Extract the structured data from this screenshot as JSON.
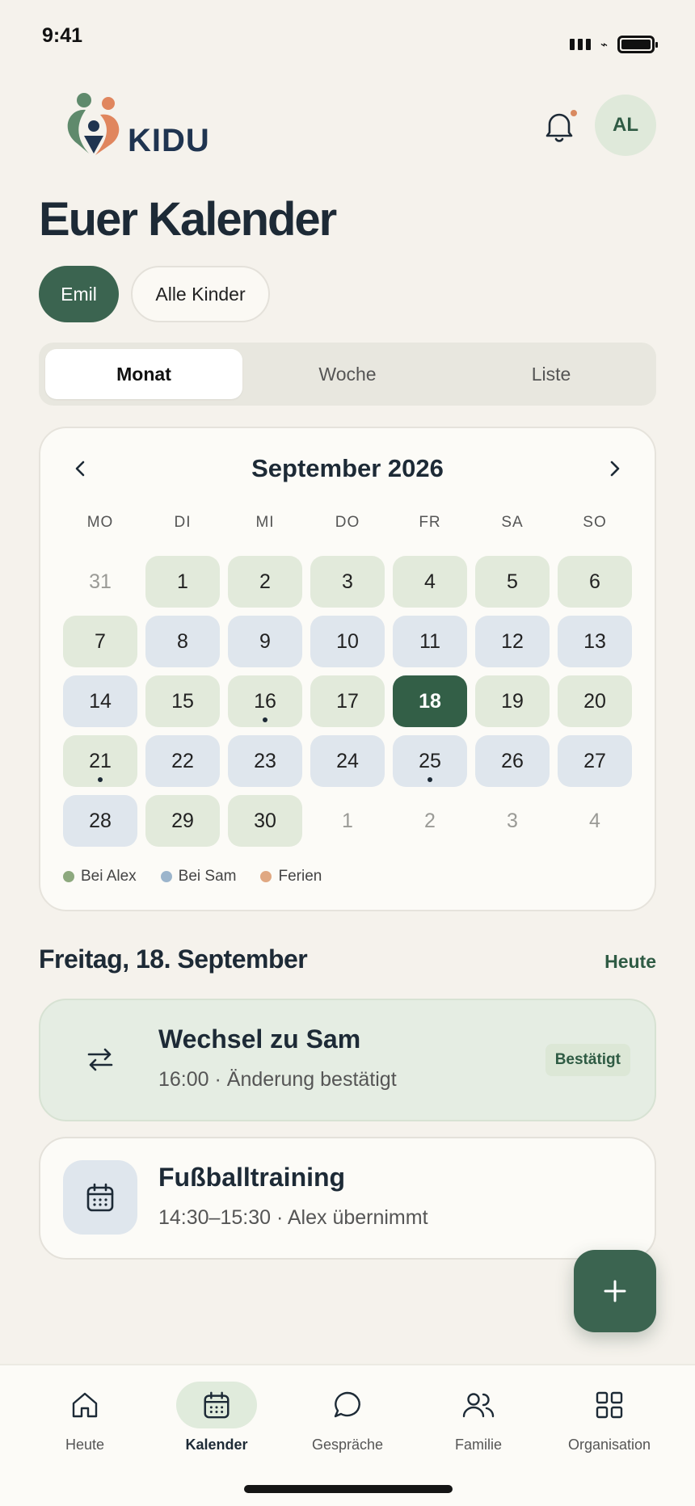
{
  "status": {
    "time": "9:41"
  },
  "app": {
    "brand": "KIDU",
    "avatar_initials": "AL",
    "title": "Euer Kalender"
  },
  "colors": {
    "accent": "#3b6450",
    "alex": "#8da97e",
    "sam": "#9cb5cc",
    "holiday": "#e0a882"
  },
  "chips": {
    "emil": "Emil",
    "all": "Alle Kinder"
  },
  "segments": {
    "month": "Monat",
    "week": "Woche",
    "list": "Liste"
  },
  "calendar": {
    "month_title": "September 2026",
    "weekdays": [
      "MO",
      "DI",
      "MI",
      "DO",
      "FR",
      "SA",
      "SO"
    ],
    "days": [
      {
        "d": "31",
        "t": "out"
      },
      {
        "d": "1",
        "t": "alex"
      },
      {
        "d": "2",
        "t": "alex"
      },
      {
        "d": "3",
        "t": "alex"
      },
      {
        "d": "4",
        "t": "alex"
      },
      {
        "d": "5",
        "t": "alex"
      },
      {
        "d": "6",
        "t": "alex"
      },
      {
        "d": "7",
        "t": "alex"
      },
      {
        "d": "8",
        "t": "sam"
      },
      {
        "d": "9",
        "t": "sam"
      },
      {
        "d": "10",
        "t": "sam"
      },
      {
        "d": "11",
        "t": "sam"
      },
      {
        "d": "12",
        "t": "sam"
      },
      {
        "d": "13",
        "t": "sam"
      },
      {
        "d": "14",
        "t": "sam"
      },
      {
        "d": "15",
        "t": "alex"
      },
      {
        "d": "16",
        "t": "alex",
        "dot": true
      },
      {
        "d": "17",
        "t": "alex"
      },
      {
        "d": "18",
        "t": "today"
      },
      {
        "d": "19",
        "t": "alex"
      },
      {
        "d": "20",
        "t": "alex"
      },
      {
        "d": "21",
        "t": "alex",
        "dot": true
      },
      {
        "d": "22",
        "t": "sam"
      },
      {
        "d": "23",
        "t": "sam"
      },
      {
        "d": "24",
        "t": "sam"
      },
      {
        "d": "25",
        "t": "sam",
        "dot": true
      },
      {
        "d": "26",
        "t": "sam"
      },
      {
        "d": "27",
        "t": "sam"
      },
      {
        "d": "28",
        "t": "sam"
      },
      {
        "d": "29",
        "t": "alex"
      },
      {
        "d": "30",
        "t": "alex"
      },
      {
        "d": "1",
        "t": "out"
      },
      {
        "d": "2",
        "t": "out"
      },
      {
        "d": "3",
        "t": "out"
      },
      {
        "d": "4",
        "t": "out"
      }
    ],
    "legend": {
      "alex": "Bei Alex",
      "sam": "Bei Sam",
      "holiday": "Ferien"
    }
  },
  "day_view": {
    "heading": "Freitag, 18. September",
    "today_link": "Heute"
  },
  "events": [
    {
      "title": "Wechsel zu Sam",
      "subtitle": "16:00 · Änderung bestätigt",
      "badge": "Bestätigt",
      "icon": "swap-icon"
    },
    {
      "title": "Fußballtraining",
      "subtitle": "14:30–15:30 · Alex übernimmt",
      "icon": "calendar-icon"
    }
  ],
  "tabs": {
    "today": "Heute",
    "calendar": "Kalender",
    "chats": "Gespräche",
    "family": "Familie",
    "organisation": "Organisation"
  }
}
